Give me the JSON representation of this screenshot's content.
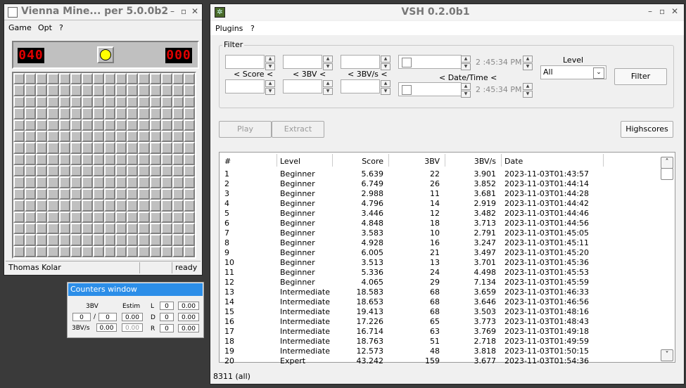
{
  "minesweeper": {
    "title": "Vienna Mine... per 5.0.0b2",
    "menu": [
      "Game",
      "Opt",
      "?"
    ],
    "mine_counter": "040",
    "timer": "000",
    "grid_rows": 16,
    "grid_cols": 16,
    "status_player": "Thomas Kolar",
    "status_state": "ready"
  },
  "counters": {
    "title": "Counters window",
    "col_3bv": "3BV",
    "col_estim": "Estim",
    "bv_value": "0",
    "bv_sep": "/",
    "bv_total": "0",
    "bv_estim": "0.00",
    "label_3bvs": "3BV/s",
    "bvs_value": "0.00",
    "bvs_estim": "0.00",
    "L_label": "L",
    "L_count": "0",
    "L_value": "0.00",
    "D_label": "D",
    "D_count": "0",
    "D_value": "0.00",
    "R_label": "R",
    "R_count": "0",
    "R_value": "0.00"
  },
  "vsh": {
    "title": "VSH 0.2.0b1",
    "menu": [
      "Plugins",
      "?"
    ],
    "filter_legend": "Filter",
    "label_score": "< Score <",
    "label_3bv": "< 3BV <",
    "label_3bvs": "< 3BV/s <",
    "label_datetime": "< Date/Time <",
    "time_from": "2 :45:34 PM",
    "time_to": "2 :45:34 PM",
    "level_label": "Level",
    "level_selected": "All",
    "filter_button": "Filter",
    "play_button": "Play",
    "extract_button": "Extract",
    "highscores_button": "Highscores",
    "columns": [
      "#",
      "Level",
      "Score",
      "3BV",
      "3BV/s",
      "Date"
    ],
    "rows": [
      [
        "1",
        "Beginner",
        "5.639",
        "22",
        "3.901",
        "2023-11-03T01:43:57"
      ],
      [
        "2",
        "Beginner",
        "6.749",
        "26",
        "3.852",
        "2023-11-03T01:44:14"
      ],
      [
        "3",
        "Beginner",
        "2.988",
        "11",
        "3.681",
        "2023-11-03T01:44:28"
      ],
      [
        "4",
        "Beginner",
        "4.796",
        "14",
        "2.919",
        "2023-11-03T01:44:42"
      ],
      [
        "5",
        "Beginner",
        "3.446",
        "12",
        "3.482",
        "2023-11-03T01:44:46"
      ],
      [
        "6",
        "Beginner",
        "4.848",
        "18",
        "3.713",
        "2023-11-03T01:44:56"
      ],
      [
        "7",
        "Beginner",
        "3.583",
        "10",
        "2.791",
        "2023-11-03T01:45:05"
      ],
      [
        "8",
        "Beginner",
        "4.928",
        "16",
        "3.247",
        "2023-11-03T01:45:11"
      ],
      [
        "9",
        "Beginner",
        "6.005",
        "21",
        "3.497",
        "2023-11-03T01:45:20"
      ],
      [
        "10",
        "Beginner",
        "3.513",
        "13",
        "3.701",
        "2023-11-03T01:45:36"
      ],
      [
        "11",
        "Beginner",
        "5.336",
        "24",
        "4.498",
        "2023-11-03T01:45:53"
      ],
      [
        "12",
        "Beginner",
        "4.065",
        "29",
        "7.134",
        "2023-11-03T01:45:59"
      ],
      [
        "13",
        "Intermediate",
        "18.583",
        "68",
        "3.659",
        "2023-11-03T01:46:33"
      ],
      [
        "14",
        "Intermediate",
        "18.653",
        "68",
        "3.646",
        "2023-11-03T01:46:56"
      ],
      [
        "15",
        "Intermediate",
        "19.413",
        "68",
        "3.503",
        "2023-11-03T01:48:16"
      ],
      [
        "16",
        "Intermediate",
        "17.226",
        "65",
        "3.773",
        "2023-11-03T01:48:43"
      ],
      [
        "17",
        "Intermediate",
        "16.714",
        "63",
        "3.769",
        "2023-11-03T01:49:18"
      ],
      [
        "18",
        "Intermediate",
        "18.763",
        "51",
        "2.718",
        "2023-11-03T01:49:59"
      ],
      [
        "19",
        "Intermediate",
        "12.573",
        "48",
        "3.818",
        "2023-11-03T01:50:15"
      ],
      [
        "20",
        "Expert",
        "43.242",
        "159",
        "3.677",
        "2023-11-03T01:54:36"
      ]
    ],
    "status": "8311 (all)"
  },
  "colors": {
    "led_red": "#e00000",
    "counters_title_bg": "#2c8ee8",
    "smiley": "#ffff00"
  }
}
